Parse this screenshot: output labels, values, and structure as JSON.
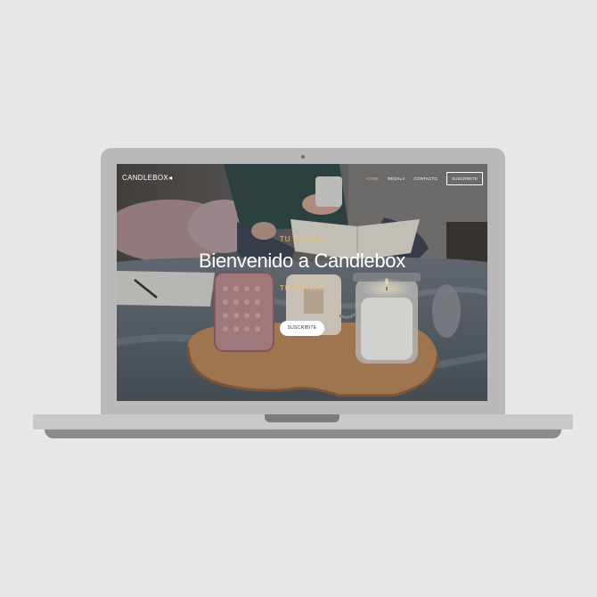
{
  "nav": {
    "brand": "CANDLEBOX",
    "links": [
      "HOME",
      "REGALA",
      "CONTACTO"
    ],
    "cta": "SUSCRIBITE"
  },
  "hero": {
    "kicker_top": "TU BRILLO",
    "title": "Bienvenido a Candlebox",
    "kicker_bottom": "TU ESTILO",
    "button": "SUSCRIBITE"
  },
  "colors": {
    "accent": "#e7b46a",
    "background": "#e8e8e8",
    "laptop": "#b9b9b9"
  }
}
